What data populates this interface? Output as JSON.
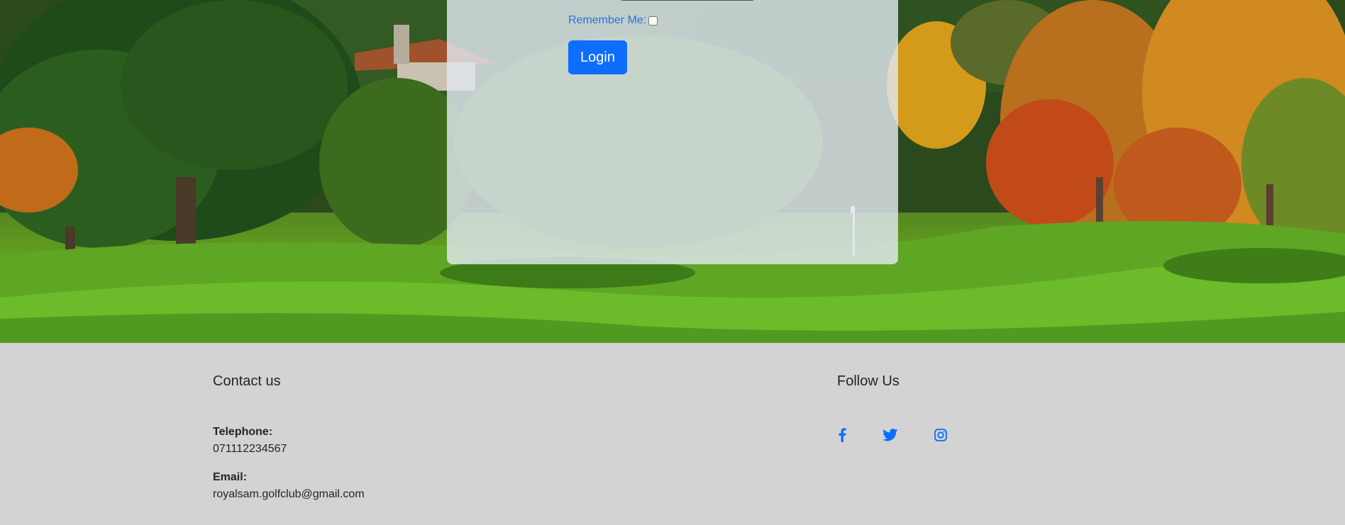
{
  "login": {
    "remember_label": "Remember Me:",
    "remember_checked": false,
    "button_label": "Login"
  },
  "footer": {
    "contact_title": "Contact us",
    "telephone_label": "Telephone:",
    "telephone_value": "071112234567",
    "email_label": "Email:",
    "email_value": "royalsam.golfclub@gmail.com",
    "follow_title": "Follow Us",
    "social_icons": [
      "facebook-icon",
      "twitter-icon",
      "instagram-icon"
    ]
  },
  "colors": {
    "accent": "#0d6efd",
    "footer_bg": "#d3d3d3",
    "link_blue": "#2f6fe0"
  }
}
